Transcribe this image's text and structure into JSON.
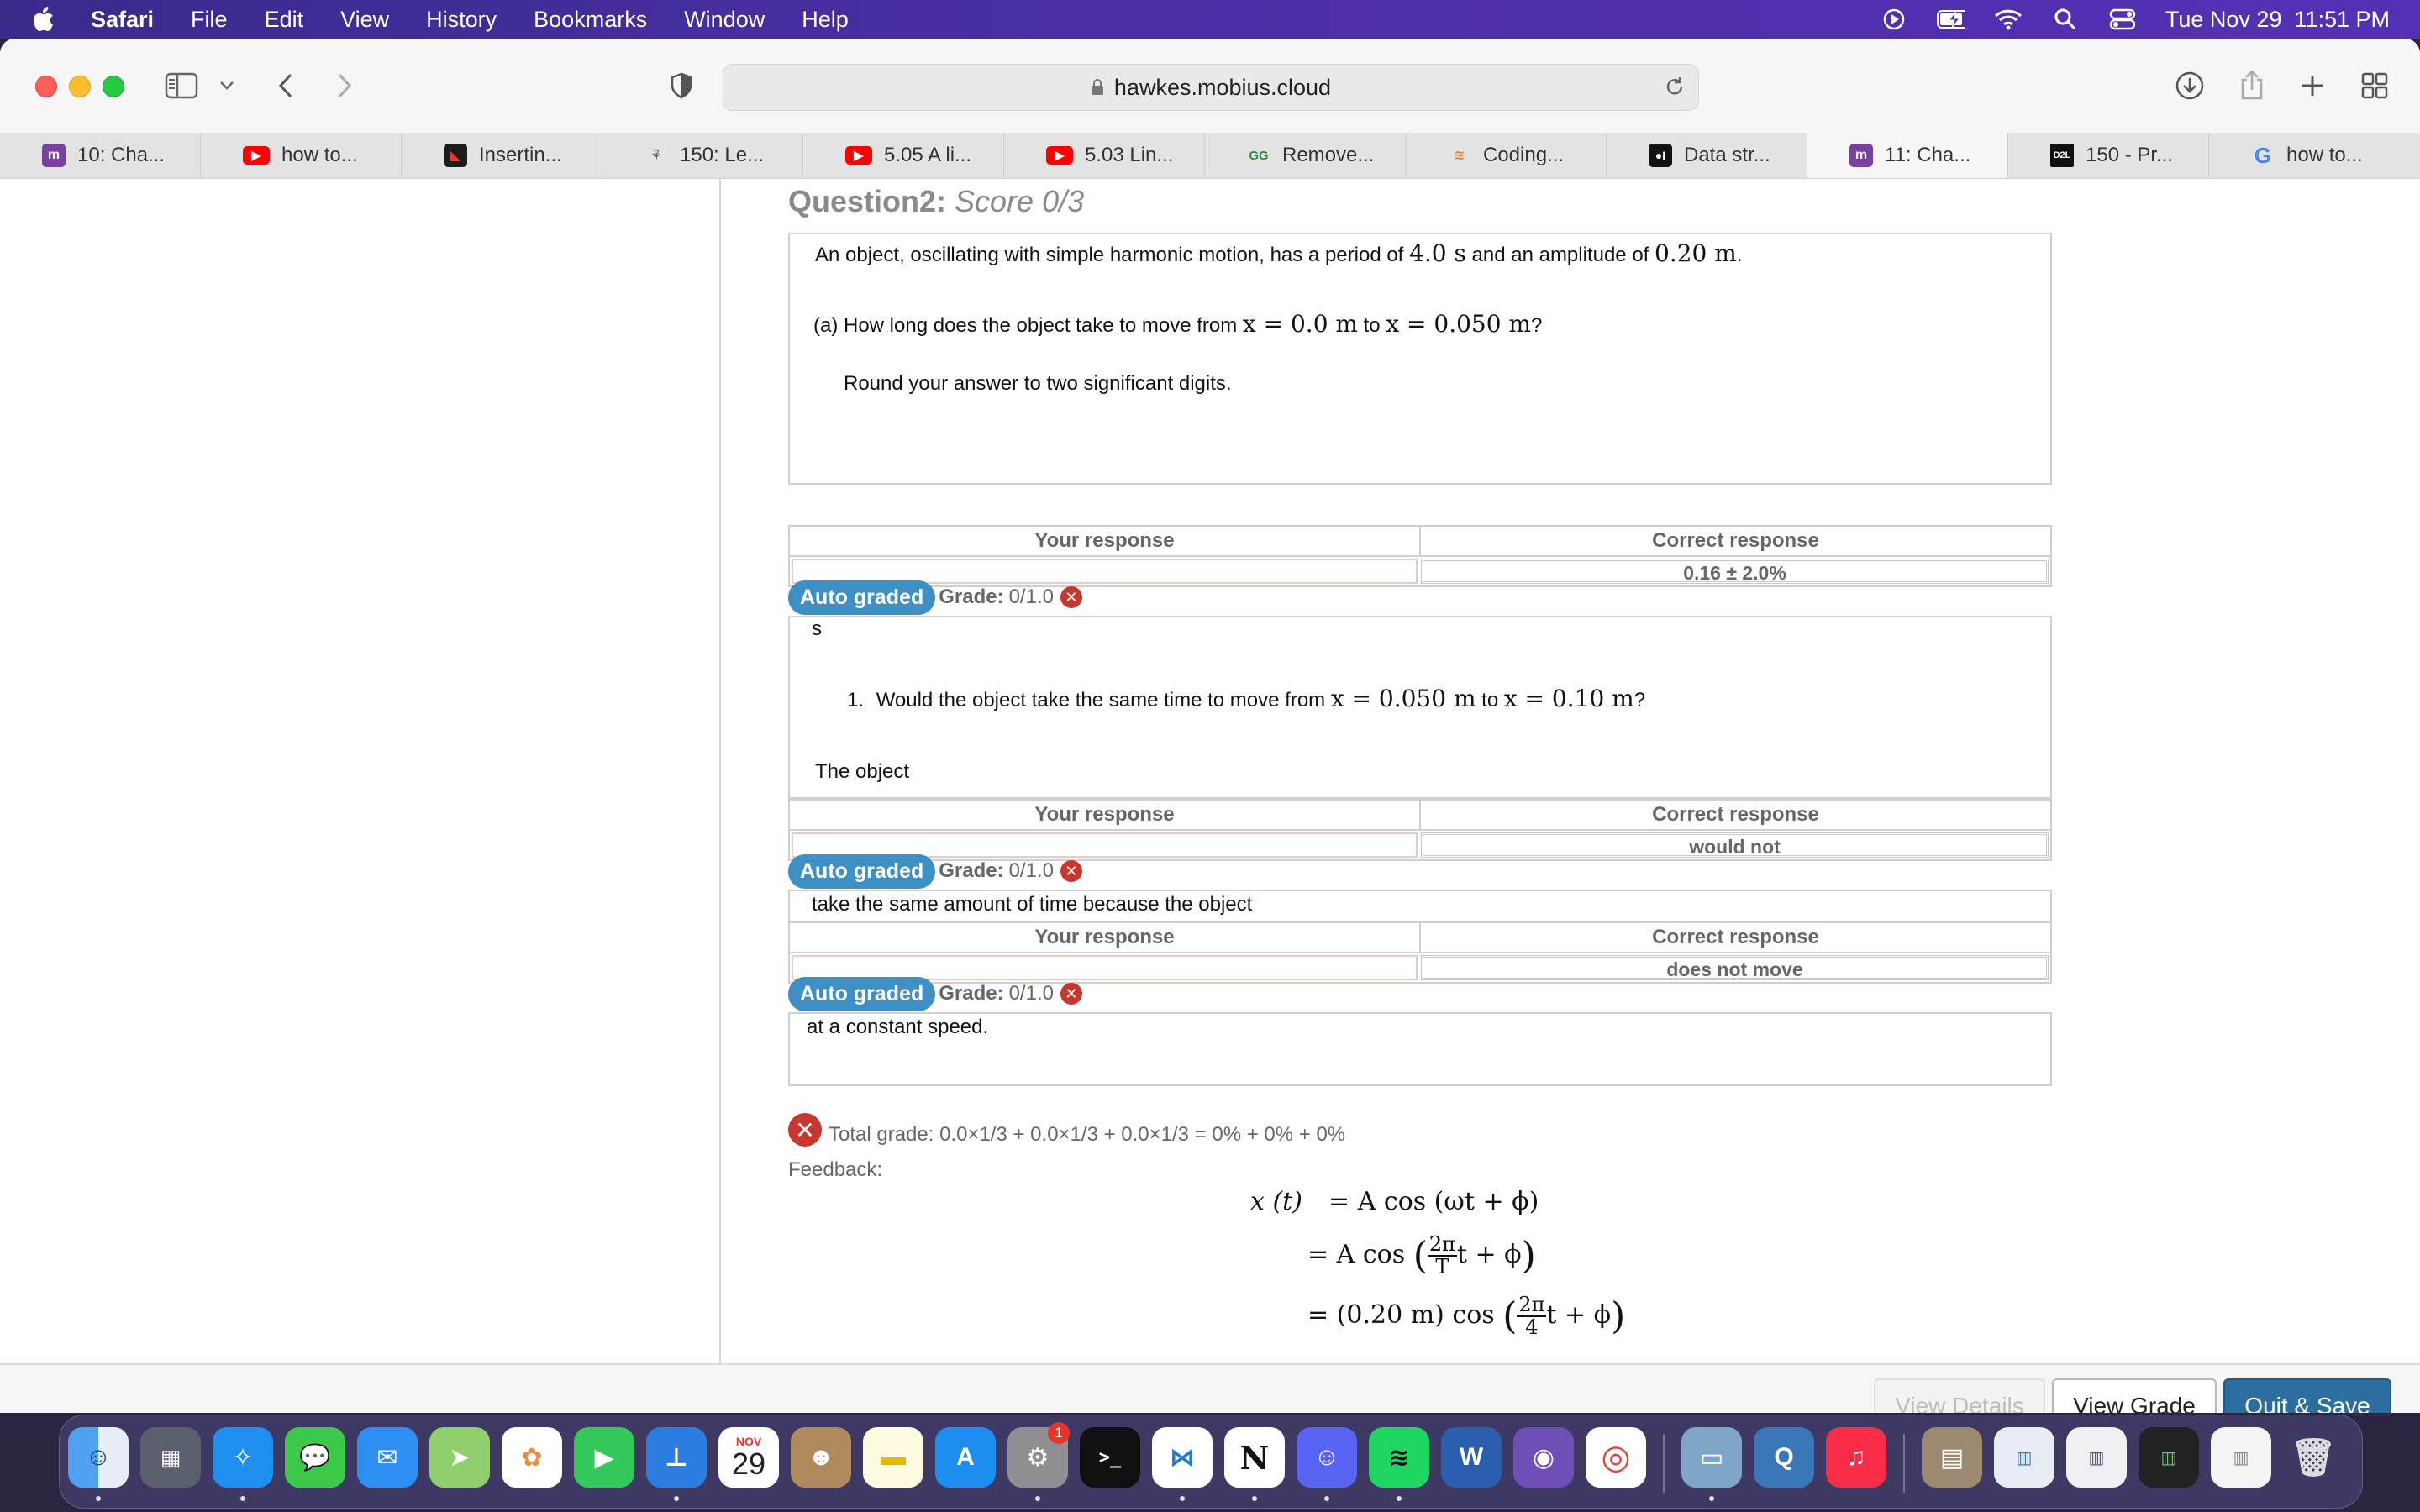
{
  "menubar": {
    "app": "Safari",
    "items": [
      "File",
      "Edit",
      "View",
      "History",
      "Bookmarks",
      "Window",
      "Help"
    ],
    "datetime": "Tue Nov 29  11:51 PM"
  },
  "browser": {
    "url": "hawkes.mobius.cloud",
    "tabs": [
      {
        "label": "10: Cha...",
        "icon": "mobius-m"
      },
      {
        "label": "how to...",
        "icon": "youtube"
      },
      {
        "label": "Insertin...",
        "icon": "play-dark"
      },
      {
        "label": "150: Le...",
        "icon": "tree"
      },
      {
        "label": "5.05 A li...",
        "icon": "youtube"
      },
      {
        "label": "5.03 Lin...",
        "icon": "youtube"
      },
      {
        "label": "Remove...",
        "icon": "geeksforgeeks"
      },
      {
        "label": "Coding...",
        "icon": "stackoverflow"
      },
      {
        "label": "Data str...",
        "icon": "medium"
      },
      {
        "label": "11: Cha...",
        "icon": "mobius-m"
      },
      {
        "label": "150 - Pr...",
        "icon": "d2l"
      },
      {
        "label": "how to...",
        "icon": "google"
      }
    ],
    "active_tab": 9
  },
  "question": {
    "title_bold": "Question2:",
    "title_score": "Score 0/3",
    "intro_pre": "An object, oscillating with simple harmonic motion, has a period of",
    "period": "4.0 s",
    "intro_mid": "and an amplitude of",
    "amplitude": "0.20 m",
    "intro_end": ".",
    "part_a_pre": "(a) How long does the object take to move from",
    "part_a_from": "x = 0.0 m",
    "part_a_to_word": "to",
    "part_a_to": "x = 0.050 m",
    "part_a_end": "?",
    "round_note": "Round your answer to two significant digits.",
    "unit_s": "s",
    "part_1_num": "1.",
    "part_1_pre": "Would the object take the same time to move from",
    "part_1_from": "x = 0.050 m",
    "part_1_to_word": "to",
    "part_1_to": "x = 0.10 m",
    "part_1_end": "?",
    "the_object": "The object",
    "same_time_text": "take the same amount of time because the object",
    "constant_speed": "at a constant speed."
  },
  "responses": [
    {
      "your_header": "Your response",
      "correct_header": "Correct response",
      "correct": "0.16 ± 2.0%",
      "badge": "Auto graded",
      "grade_label": "Grade:",
      "grade_value": "0/1.0"
    },
    {
      "your_header": "Your response",
      "correct_header": "Correct response",
      "correct": "would not",
      "badge": "Auto graded",
      "grade_label": "Grade:",
      "grade_value": "0/1.0"
    },
    {
      "your_header": "Your response",
      "correct_header": "Correct response",
      "correct": "does not move",
      "badge": "Auto graded",
      "grade_label": "Grade:",
      "grade_value": "0/1.0"
    }
  ],
  "summary": {
    "total": "Total grade: 0.0×1/3 + 0.0×1/3 + 0.0×1/3 = 0% + 0% + 0%",
    "feedback_label": "Feedback:"
  },
  "feedback_eq": {
    "line1_lhs": "x (t)",
    "line1_rhs": "= A cos (ωt + ϕ)",
    "line2_pre": "= A cos",
    "line2_num": "2π",
    "line2_den": "T",
    "line2_post": "t + ϕ",
    "line3_pre": "= (0.20 m) cos",
    "line3_num": "2π",
    "line3_den": "4",
    "line3_post": "t + ϕ"
  },
  "buttons": {
    "view_details": "View Details",
    "view_grade": "View Grade",
    "quit_save": "Quit & Save"
  },
  "dock": {
    "calendar_month": "NOV",
    "calendar_day": "29",
    "settings_badge": "1"
  }
}
